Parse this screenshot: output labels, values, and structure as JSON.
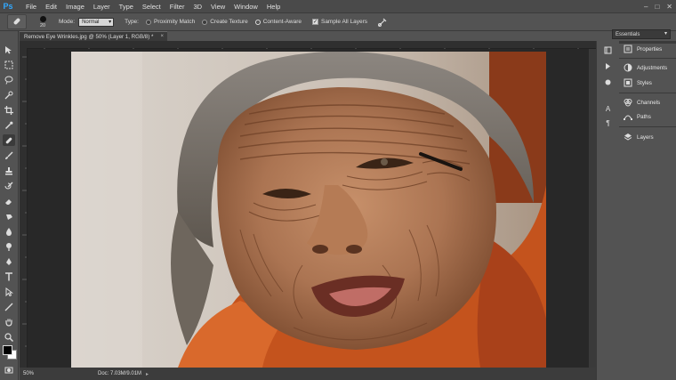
{
  "app": {
    "logo": "Ps"
  },
  "menu": [
    "File",
    "Edit",
    "Image",
    "Layer",
    "Type",
    "Select",
    "Filter",
    "3D",
    "View",
    "Window",
    "Help"
  ],
  "window_controls": [
    "–",
    "□",
    "✕"
  ],
  "options": {
    "brush_size": "20",
    "mode_label": "Mode:",
    "mode_value": "Normal",
    "type_label": "Type:",
    "type_options": [
      {
        "label": "Proximity Match",
        "selected": false
      },
      {
        "label": "Create Texture",
        "selected": false
      },
      {
        "label": "Content-Aware",
        "selected": true
      }
    ],
    "sample_all_layers": "Sample All Layers",
    "sample_all_layers_checked": true,
    "workspace": "Essentials"
  },
  "document": {
    "tab_title": "Remove Eye Wrinkles.jpg @ 50% (Layer 1, RGB/8) *",
    "tab_close": "×"
  },
  "status": {
    "zoom": "50%",
    "doc_info": "Doc: 7.03M/9.01M",
    "arrow": "▸"
  },
  "colors": {
    "foreground": "#000000",
    "background": "#ffffff",
    "marker_stroke": "#1a1410"
  },
  "toolbar_icons": [
    "move-icon",
    "marquee-icon",
    "lasso-icon",
    "quick-select-icon",
    "crop-icon",
    "eyedropper-icon",
    "spot-healing-icon",
    "brush-icon",
    "clone-stamp-icon",
    "history-brush-icon",
    "eraser-icon",
    "gradient-icon",
    "blur-icon",
    "dodge-icon",
    "pen-icon",
    "type-icon",
    "path-select-icon",
    "shape-icon",
    "hand-icon",
    "zoom-icon"
  ],
  "panels": [
    {
      "label": "Properties",
      "icon": "properties-icon"
    },
    {
      "label": "Adjustments",
      "icon": "adjustments-icon"
    },
    {
      "label": "Styles",
      "icon": "styles-icon"
    },
    {
      "label": "Channels",
      "icon": "channels-icon"
    },
    {
      "label": "Paths",
      "icon": "paths-icon"
    },
    {
      "label": "Layers",
      "icon": "layers-icon"
    }
  ]
}
